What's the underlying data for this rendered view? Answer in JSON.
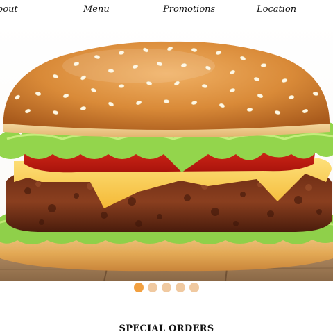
{
  "nav": {
    "items": [
      {
        "label": "bout"
      },
      {
        "label": "Menu"
      },
      {
        "label": "Promotions"
      },
      {
        "label": "Location"
      }
    ]
  },
  "hero": {
    "image": "burger-photo"
  },
  "carousel": {
    "total_slides": 5,
    "active_index": 0,
    "active_color": "#f2a040",
    "inactive_color": "#f0c9a0"
  },
  "specials": {
    "title": "SPECIAL ORDERS"
  }
}
